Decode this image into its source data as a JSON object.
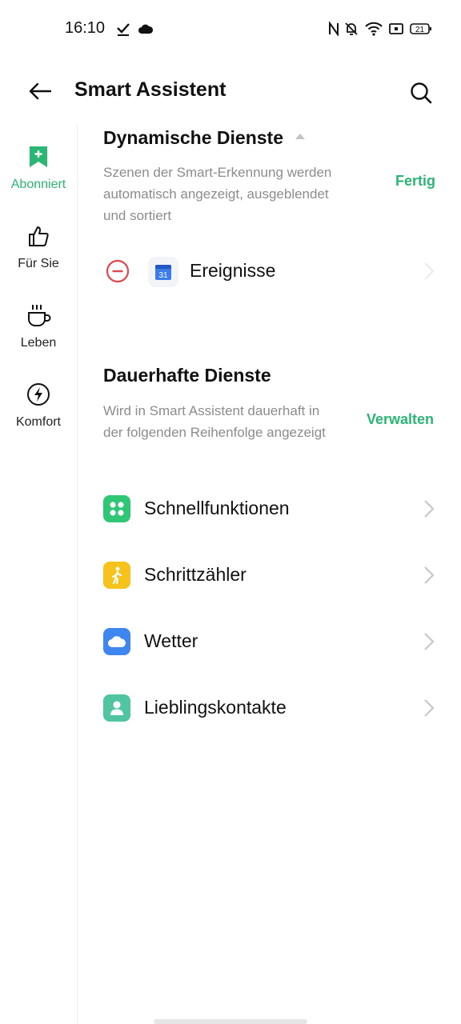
{
  "status_bar": {
    "time": "16:10",
    "battery": "21"
  },
  "header": {
    "title": "Smart Assistent"
  },
  "sidebar": {
    "items": [
      {
        "label": "Abonniert",
        "icon": "bookmark-plus-icon"
      },
      {
        "label": "Für Sie",
        "icon": "thumbs-up-icon"
      },
      {
        "label": "Leben",
        "icon": "coffee-cup-icon"
      },
      {
        "label": "Komfort",
        "icon": "lightning-icon"
      }
    ]
  },
  "dynamic": {
    "title": "Dynamische Dienste",
    "description": "Szenen der Smart-Erkennung werden automatisch angezeigt, ausgeblendet und sortiert",
    "action": "Fertig",
    "items": [
      {
        "label": "Ereignisse",
        "icon_text": "31"
      }
    ]
  },
  "permanent": {
    "title": "Dauerhafte Dienste",
    "description": "Wird in Smart Assistent dauerhaft in der folgenden Reihenfolge angezeigt",
    "action": "Verwalten",
    "items": [
      {
        "label": "Schnellfunktionen",
        "icon": "quick-functions-icon",
        "color": "#2fc676"
      },
      {
        "label": "Schrittzähler",
        "icon": "walking-person-icon",
        "color": "#f6c21c"
      },
      {
        "label": "Wetter",
        "icon": "cloud-icon",
        "color": "#3f86f0"
      },
      {
        "label": "Lieblingskontakte",
        "icon": "contact-icon",
        "color": "#4fc6a0"
      }
    ]
  },
  "colors": {
    "accent": "#2ab673",
    "remove": "#e0484f"
  }
}
